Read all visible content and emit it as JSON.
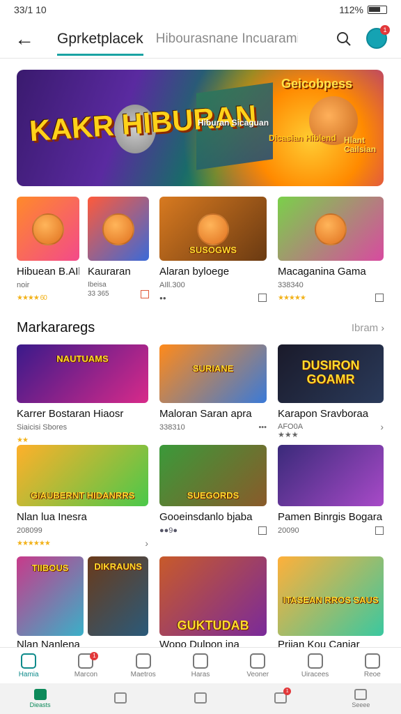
{
  "status_bar": {
    "time": "33/1 10",
    "right_text": "112%"
  },
  "app_bar": {
    "back_icon": "arrow-left-icon",
    "active_tab": "Gprketplacek",
    "inactive_tab": "Hibourasnane Incuarami",
    "search_icon": "search-icon",
    "avatar_badge": "1"
  },
  "hero": {
    "title": "KAKR HIBURAN",
    "top_right": "Geicobpess",
    "mid_label": "Hiburan Sicaguan",
    "right_label_1": "Dicasian Hiblend",
    "right_label_2": "Hlant Cailsian"
  },
  "featured": [
    {
      "title": "Hibuean B.AIk",
      "sub": "noir",
      "rating": "★★★★ 60",
      "thumb_text": "",
      "colors": [
        "#ff8a2a",
        "#f34a8a"
      ]
    },
    {
      "title": "Kauraran",
      "sub": "Ibeisa\n33 365",
      "thumb_text": "",
      "colors": [
        "#ff5a3a",
        "#3a6ad8"
      ]
    },
    {
      "title": "Alaran byloege",
      "sub": "AIll.300",
      "rating": "●●",
      "thumb_text": "SUSOGWS",
      "colors": [
        "#d87a20",
        "#6a3a12"
      ]
    },
    {
      "title": "Macaganina Gama",
      "sub": "338340",
      "rating": "★★★★★",
      "thumb_text": "",
      "colors": [
        "#7ad04a",
        "#d84aa0"
      ]
    }
  ],
  "section": {
    "title": "Markararegs",
    "more": "Ibram"
  },
  "row2": [
    {
      "title": "Karrer Bostaran Hiaosr",
      "sub": "Siaicisi Sbores",
      "rating": "★★",
      "thumb_text": "NAUTUAMS",
      "colors": [
        "#3a1a8a",
        "#d82a8a"
      ]
    },
    {
      "title": "Maloran Saran apra",
      "sub": "338310",
      "rating": "•••",
      "thumb_text": "SURIANE",
      "colors": [
        "#ff8a1a",
        "#3a7ad8"
      ]
    },
    {
      "title": "Karapon Sravboraa",
      "sub": "AFO0A\n★★★",
      "thumb_text": "DUSIRON GOAMR",
      "colors": [
        "#1a1a2a",
        "#2a3a5a"
      ]
    }
  ],
  "row3": [
    {
      "title": "Nlan lua Inesra",
      "sub": "208099",
      "rating": "★★★★★★",
      "thumb_text": "GIAUBERNT   HIDANRRS",
      "colors": [
        "#ffb02a",
        "#4ac84a"
      ]
    },
    {
      "title": "Gooeinsdanlo bjaba",
      "sub": "●●9●",
      "thumb_text": "SUEGORDS",
      "colors": [
        "#3a9a3a",
        "#8a5a2a"
      ]
    },
    {
      "title": "Pamen Binrgis Bogara",
      "sub": "20090",
      "thumb_text": "",
      "colors": [
        "#3a2a7a",
        "#a84ac8"
      ]
    }
  ],
  "row4": [
    {
      "title": "Nlan Nanlena",
      "thumb_text": "TIIBOUS",
      "colors": [
        "#c83a8a",
        "#3ab0c8"
      ]
    },
    {
      "title": "",
      "thumb_text": "DIKRAUNS",
      "colors": [
        "#6a3a1a",
        "#2a5a7a"
      ]
    },
    {
      "title": "Wopo Dulpon ina",
      "thumb_text": "GUKTUDAB",
      "colors": [
        "#c85a2a",
        "#7a2a9a"
      ]
    },
    {
      "title": "Priian Kou Caniar",
      "thumb_text": "ITASEAN RROS SAUS",
      "colors": [
        "#ffb03a",
        "#3ac8a0"
      ]
    }
  ],
  "tab_bar": [
    {
      "label": "Hamia",
      "icon": "home-icon",
      "active": true
    },
    {
      "label": "Marcon",
      "icon": "bag-icon",
      "badge": "1"
    },
    {
      "label": "Maetros",
      "icon": "store-icon"
    },
    {
      "label": "Haras",
      "icon": "clock-icon"
    },
    {
      "label": "Veoner",
      "icon": "badge-icon"
    },
    {
      "label": "Uiracees",
      "icon": "search-doc-icon"
    },
    {
      "label": "Reoe",
      "icon": "search-icon"
    }
  ],
  "nav_bar": [
    {
      "label": "Dieasts",
      "icon": "home-icon",
      "active": true
    },
    {
      "label": "",
      "icon": "user-icon"
    },
    {
      "label": "",
      "icon": "square-icon"
    },
    {
      "label": "",
      "icon": "music-icon",
      "badge": "1"
    },
    {
      "label": "Seeee",
      "icon": "menu-icon"
    }
  ]
}
